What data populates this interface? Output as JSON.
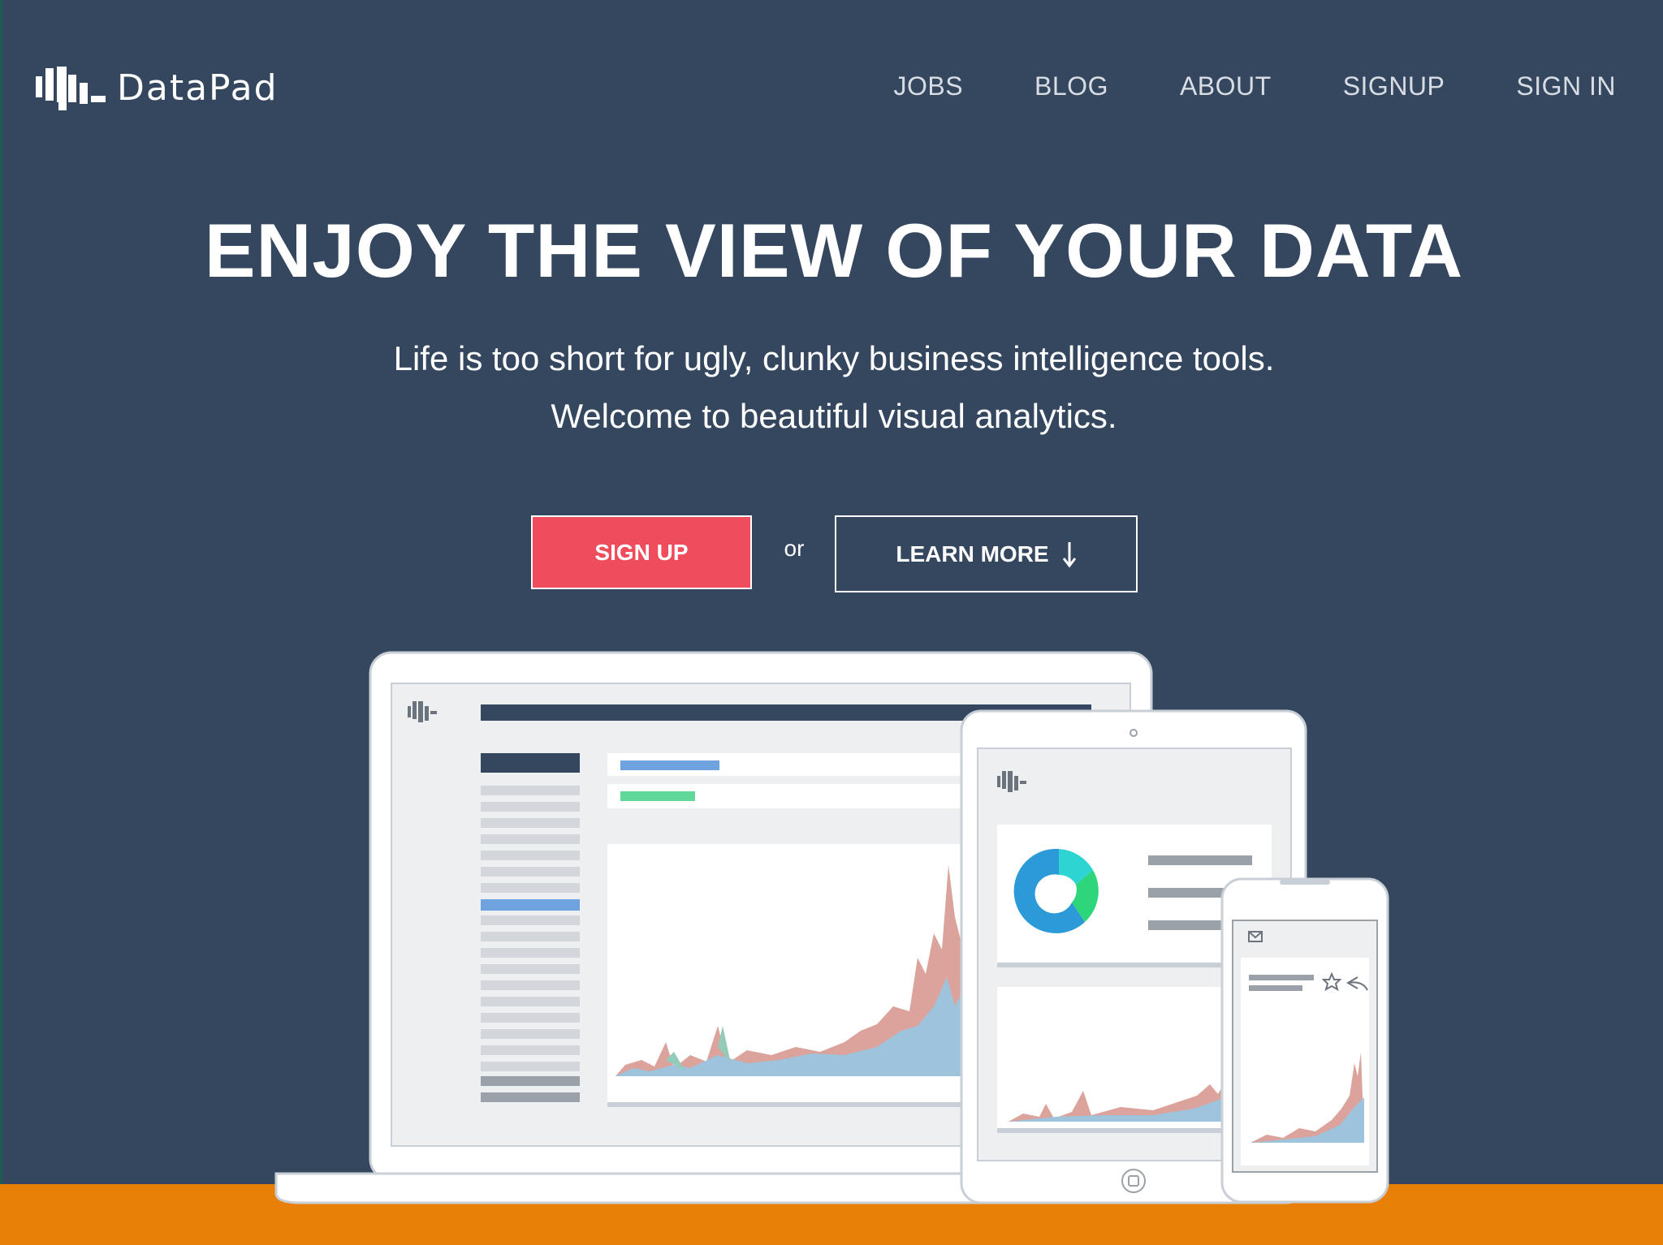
{
  "brand": {
    "name": "DataPad"
  },
  "nav": {
    "items": [
      "JOBS",
      "BLOG",
      "ABOUT",
      "SIGNUP",
      "SIGN IN"
    ]
  },
  "hero": {
    "headline": "ENJOY THE VIEW OF YOUR DATA",
    "subline_1": "Life is too short for ugly, clunky business intelligence tools.",
    "subline_2": "Welcome to beautiful visual analytics."
  },
  "cta": {
    "signup_label": "SIGN UP",
    "or_text": "or",
    "learn_more_label": "LEARN MORE"
  },
  "colors": {
    "background": "#34475f",
    "accent_red": "#ef4d5d",
    "ground_orange": "#e87f07"
  },
  "icons": {
    "logo": "datapad-logo-icon",
    "learn_more": "arrow-down-icon",
    "mail": "mail-icon",
    "star": "star-icon",
    "reply": "reply-icon"
  }
}
